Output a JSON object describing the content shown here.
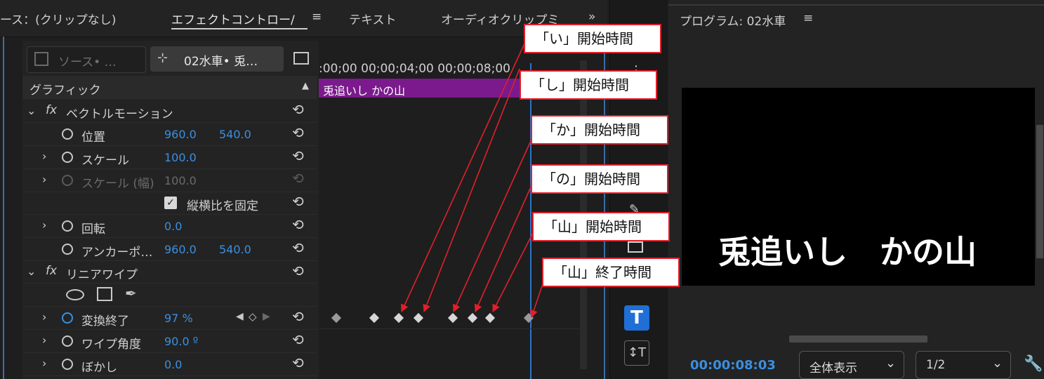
{
  "tabs": {
    "source": "ース：(クリップなし)",
    "effect_controls": "エフェクトコントロー/",
    "text": "テキスト",
    "audio": "オーディオクリップミ",
    "more": "»",
    "program": "プログラム: 02水車"
  },
  "ec": {
    "source_btn": "ソース• …",
    "seq_btn": "02水車• 兎…",
    "section": "グラフィック",
    "timecode_ruler": ":00;00  00;00;04;00  00;00;08;00",
    "clip_label": "兎追いし かの山",
    "vector_motion": "ベクトルモーション",
    "position": {
      "label": "位置",
      "x": "960.0",
      "y": "540.0"
    },
    "scale": {
      "label": "スケール",
      "value": "100.0"
    },
    "scale_width": {
      "label": "スケール (幅)",
      "value": "100.0"
    },
    "uniform": "縦横比を固定",
    "rotation": {
      "label": "回転",
      "value": "0.0"
    },
    "anchor": {
      "label": "アンカーポ…",
      "x": "960.0",
      "y": "540.0"
    },
    "linear_wipe": "リニアワイプ",
    "transition": {
      "label": "変換終了",
      "value": "97 %"
    },
    "wipe_angle": {
      "label": "ワイプ角度",
      "value": "90.0 º"
    },
    "feather": {
      "label": "ぼかし",
      "value": "0.0"
    },
    "fx": "fx"
  },
  "callouts": [
    "「い」開始時間",
    "「し」開始時間",
    "「か」開始時間",
    "「の」開始時間",
    "「山」開始時間",
    "「山」終了時間"
  ],
  "program": {
    "title_text": "兎追いし　かの山",
    "timecode": "00:00:08:03",
    "fit": "全体表示",
    "resolution": "1/2"
  },
  "colors": {
    "accent_blue": "#3b8fe0",
    "clip_purple": "#7a1a8c",
    "callout_red": "#e0202a"
  }
}
